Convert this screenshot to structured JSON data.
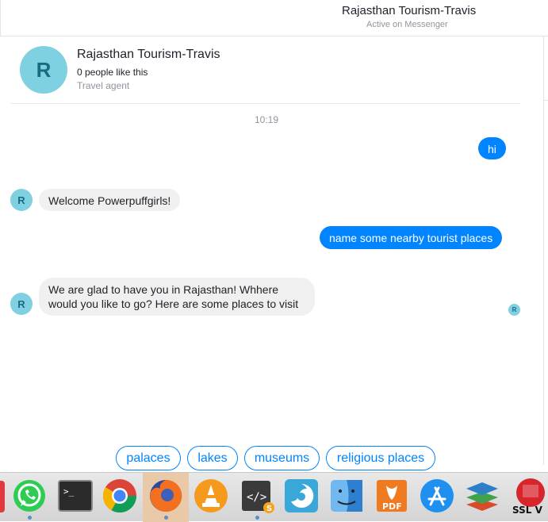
{
  "header": {
    "name": "Rajasthan Tourism-Travis",
    "status": "Active on Messenger"
  },
  "profile": {
    "avatar_letter": "R",
    "name": "Rajasthan Tourism-Travis",
    "likes": "0 people like this",
    "category": "Travel agent"
  },
  "conversation": {
    "timestamp": "10:19",
    "messages": [
      {
        "from": "user",
        "text": "hi"
      },
      {
        "from": "bot",
        "text": "Welcome Powerpuffgirls!"
      },
      {
        "from": "user",
        "text": "name some nearby tourist places"
      },
      {
        "from": "bot",
        "text": "We are glad to have you in Rajasthan!  Whhere would you like to go? Here are some places to visit"
      }
    ],
    "bot_avatar_letter": "R",
    "seen_letter": "R"
  },
  "quick_replies": [
    "palaces",
    "lakes",
    "museums",
    "religious places"
  ],
  "dock": {
    "items": [
      "whatsapp-icon",
      "terminal-icon",
      "chrome-icon",
      "firefox-icon",
      "vlc-icon",
      "sublime-text-icon",
      "shutter-icon",
      "finder-icon",
      "pdf-reader-icon",
      "app-store-icon",
      "layers-icon",
      "ssl-vpn-icon"
    ],
    "pdf_label": "PDF",
    "ssl_label": "SSL V"
  },
  "colors": {
    "accent": "#0084ff",
    "incoming_bubble": "#f1f0f0",
    "avatar": "#7fd0e0"
  }
}
